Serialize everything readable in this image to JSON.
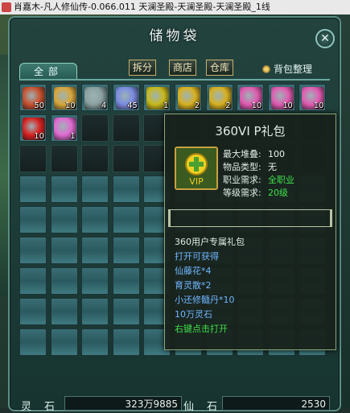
{
  "window": {
    "title": "肖嘉木-凡人修仙传-0.066.011 天澜圣殿-天澜圣殿-天澜圣殿_1线"
  },
  "panel": {
    "title": "储物袋",
    "close_label": "✕",
    "tab_all": "全部",
    "buttons": {
      "split": "拆分",
      "shop": "商店",
      "warehouse": "仓库"
    },
    "organize": "背包整理"
  },
  "slots_row1": [
    {
      "icon": "gourd-potion-icon",
      "qty": "50",
      "color": "#c8502e"
    },
    {
      "icon": "key-icon",
      "qty": "10",
      "color": "#d8a53a"
    },
    {
      "icon": "mask-icon",
      "qty": "4",
      "color": "#8aa0a0"
    },
    {
      "icon": "scroll-ticket-icon",
      "qty": "45",
      "color": "#7a8ae0"
    },
    {
      "icon": "vip-giftpack-icon",
      "qty": "1",
      "color": "#c8b81a"
    },
    {
      "icon": "gold-talisman-icon",
      "qty": "2",
      "color": "#d8b020"
    },
    {
      "icon": "gold-talisman-icon",
      "qty": "2",
      "color": "#d8b020"
    },
    {
      "icon": "pink-bundle-icon",
      "qty": "10",
      "color": "#e05ab0"
    },
    {
      "icon": "pink-bundle-icon",
      "qty": "10",
      "color": "#e05ab0"
    },
    {
      "icon": "pink-bundle-icon",
      "qty": "10",
      "color": "#e05ab0"
    }
  ],
  "slots_row2": [
    {
      "icon": "red-orb-icon",
      "qty": "10",
      "color": "#d82020"
    },
    {
      "icon": "gift-box-icon",
      "qty": "1",
      "color": "#e06ad0"
    }
  ],
  "tooltip": {
    "title": "360VI P礼包",
    "icon": "vip-giftpack-icon",
    "icon_text": "VIP",
    "stats": [
      {
        "k": "最大堆叠:",
        "v": "100"
      },
      {
        "k": "物品类型:",
        "v": "无"
      },
      {
        "k": "职业需求:",
        "v": "全职业"
      },
      {
        "k": "等级需求:",
        "v": "20级"
      }
    ],
    "desc": [
      "360用户专属礼包",
      "打开可获得",
      "仙藤花*4",
      "育灵散*2",
      "小还修髓丹*10",
      "10万灵石",
      "右键点击打开"
    ]
  },
  "footer": {
    "spirit_stone_label": "灵石",
    "spirit_stone_value": "323万9885",
    "immortal_stone_label": "仙石",
    "immortal_stone_value": "2530"
  }
}
